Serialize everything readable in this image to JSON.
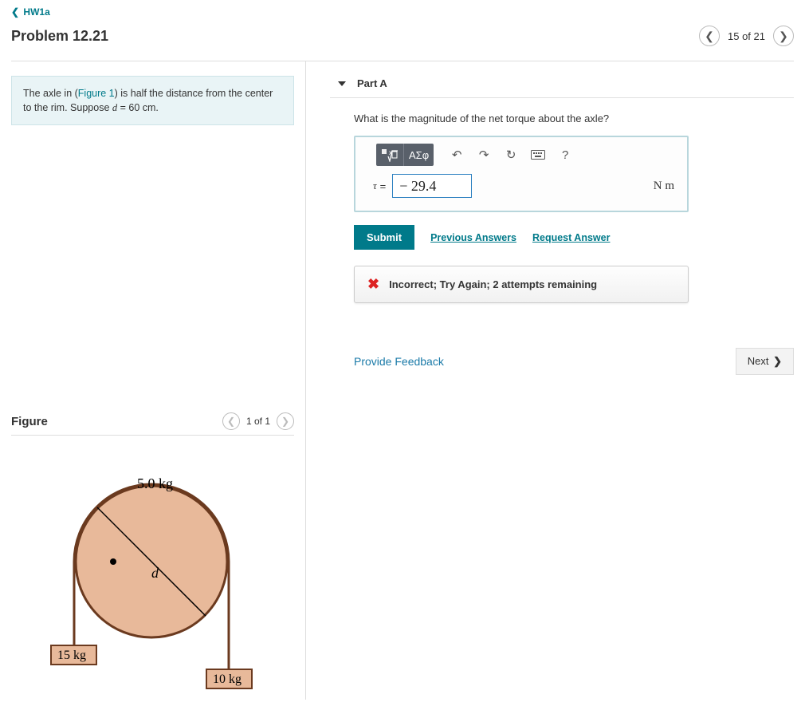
{
  "nav": {
    "back_label": "HW1a",
    "problem_title": "Problem 12.21",
    "page_position": "15 of 21"
  },
  "prompt": {
    "pre": "The axle in (",
    "figure_link": "Figure 1",
    "mid": ") is half the distance from the center to the rim. Suppose ",
    "var": "d",
    "post": " = 60 cm."
  },
  "figure": {
    "title": "Figure",
    "position": "1 of 1",
    "labels": {
      "top_mass": "5.0 kg",
      "left_mass": "15 kg",
      "right_mass": "10 kg",
      "diameter": "d"
    }
  },
  "part": {
    "label": "Part A",
    "question": "What is the magnitude of the net torque about the axle?",
    "toolbar": {
      "templates": "ΑΣφ",
      "help": "?"
    },
    "answer": {
      "symbol": "τ",
      "eq": "=",
      "value": "− 29.4",
      "unit": "N m"
    },
    "actions": {
      "submit": "Submit",
      "previous": "Previous Answers",
      "request": "Request Answer"
    },
    "feedback": "Incorrect; Try Again; 2 attempts remaining"
  },
  "footer": {
    "provide_feedback": "Provide Feedback",
    "next": "Next"
  }
}
